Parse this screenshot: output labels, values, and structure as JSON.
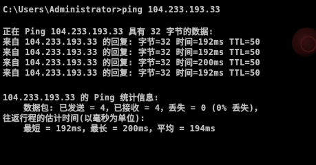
{
  "console": {
    "background": "#000000",
    "text_color": "#c0c0c0",
    "lines": [
      "C:\\Users\\Administrator>ping 104.233.193.33",
      "",
      "正在 Ping 104.233.193.33 具有 32 字节的数据:",
      "来自 104.233.193.33 的回复: 字节=32 时间=192ms TTL=50",
      "来自 104.233.193.33 的回复: 字节=32 时间=192ms TTL=50",
      "来自 104.233.193.33 的回复: 字节=32 时间=200ms TTL=50",
      "来自 104.233.193.33 的回复: 字节=32 时间=192ms TTL=50",
      "",
      "104.233.193.33 的 Ping 统计信息:",
      "    数据包: 已发送 = 4，已接收 = 4，丢失 = 0 (0% 丢失)，",
      "往返行程的估计时间(以毫秒为单位):",
      "    最短 = 192ms，最长 = 200ms，平均 = 194ms"
    ]
  }
}
